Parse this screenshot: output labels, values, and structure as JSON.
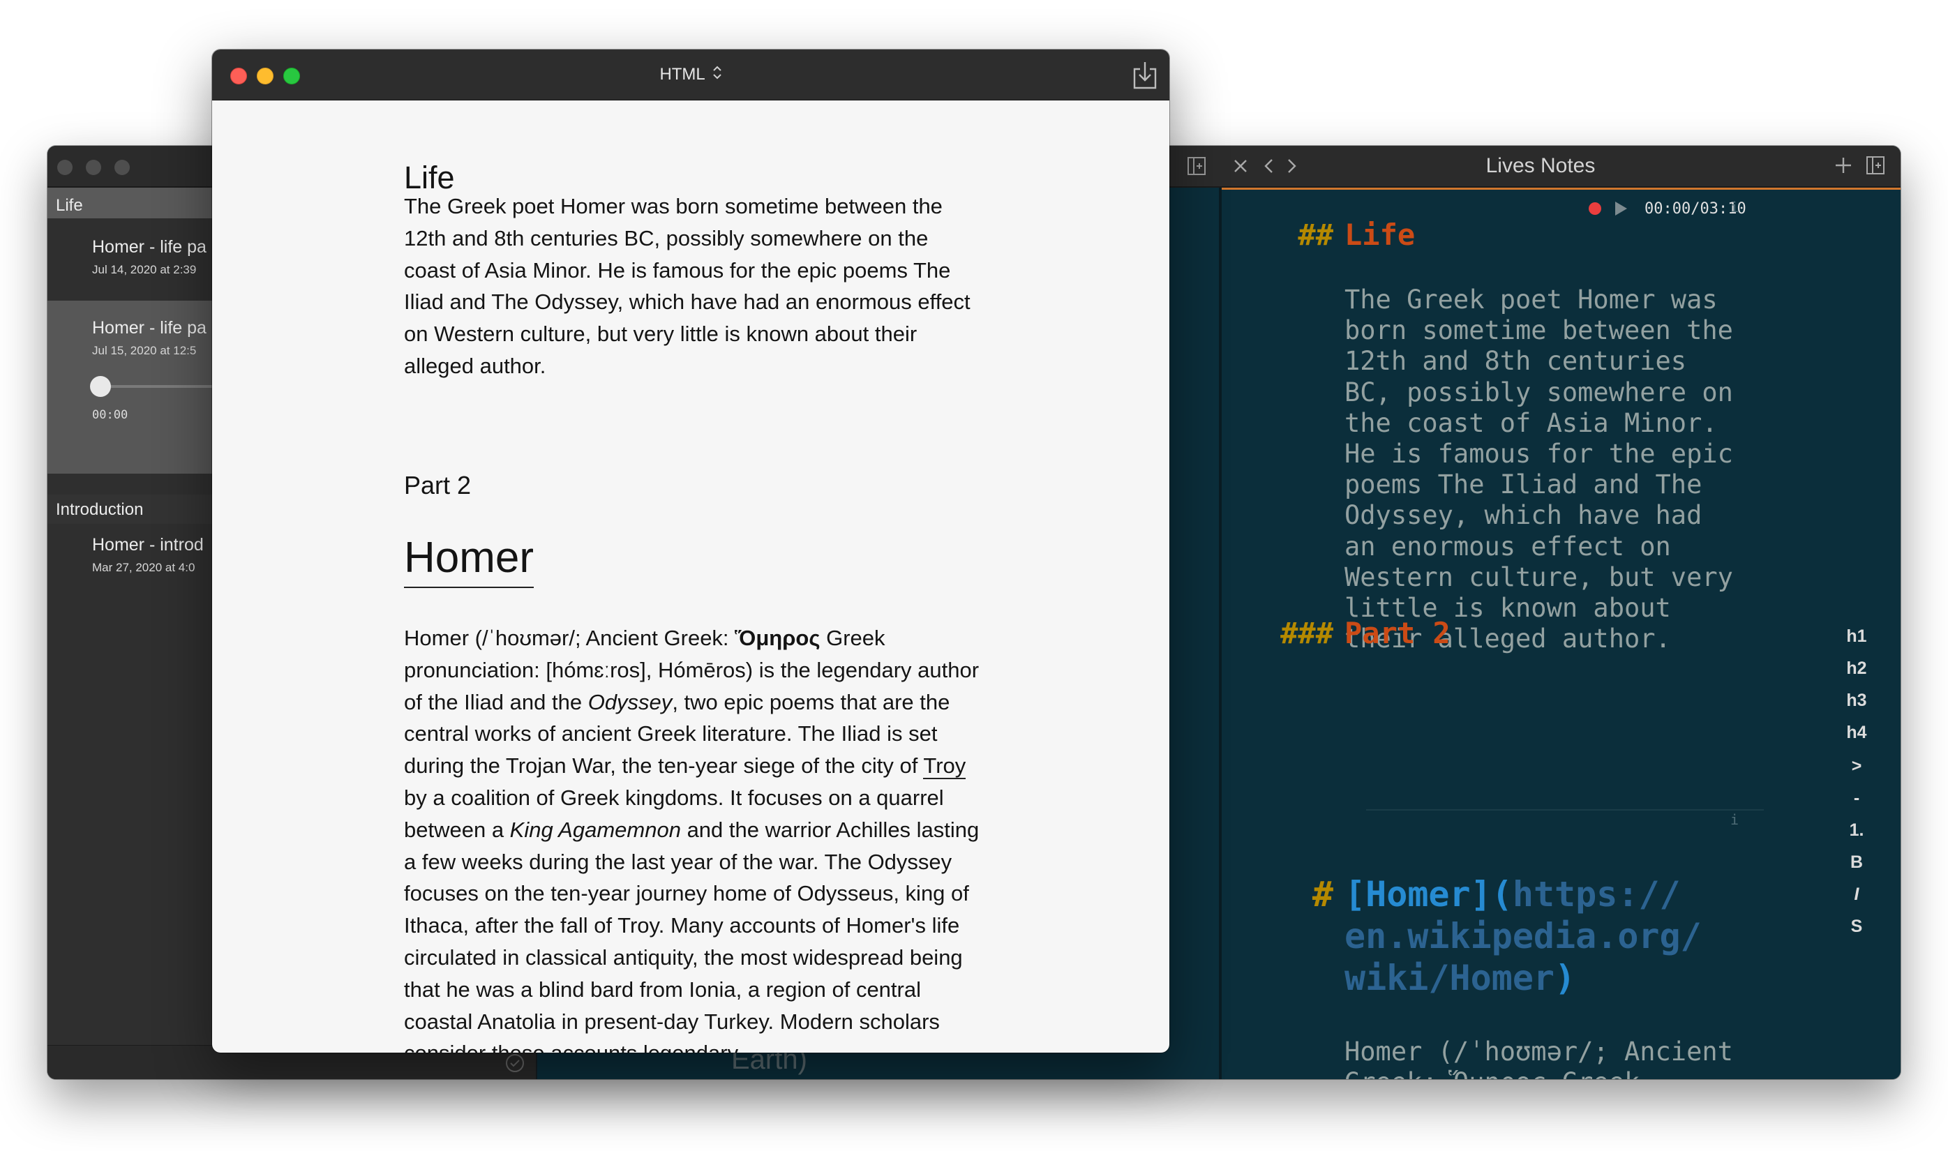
{
  "main_window": {
    "sidebar": {
      "sections": [
        {
          "label": "Life"
        },
        {
          "label": "Introduction"
        }
      ],
      "notes": [
        {
          "title": "Homer - life pa",
          "date": "Jul 14, 2020 at 2:39"
        },
        {
          "title": "Homer - life pa",
          "date": "Jul 15, 2020 at 12:5"
        },
        {
          "title": "Homer - introd",
          "date": "Mar 27, 2020 at 4:0"
        }
      ],
      "audio_time": "00:00"
    },
    "middle_pane_text": "Earth)",
    "editor": {
      "title": "Lives Notes",
      "audio_timer": "00:00/03:10",
      "info_glyph": "i",
      "line1": {
        "hashes": "##",
        "text": "Life"
      },
      "paragraph1": [
        "The Greek poet Homer was",
        "born sometime between the",
        "12th and 8th centuries",
        "BC, possibly somewhere on",
        "the coast of Asia Minor.",
        "He is famous for the epic",
        "poems The Iliad and The",
        "Odyssey, which have had",
        "an enormous effect on",
        "Western culture, but very",
        "little is known about",
        "their alleged author."
      ],
      "line2": {
        "hashes": "###",
        "text": "Part 2"
      },
      "heading_link": {
        "hash": "#",
        "open_bracket": "[",
        "text": "Homer",
        "close_bracket": "](",
        "url_lines": [
          "https://",
          "en.wikipedia.org/",
          "wiki/Homer"
        ],
        "close_paren": ")"
      },
      "last_line": "Homer (/ˈhoʊmər/; Ancient",
      "cut_line": "Greek: Ὅμηρος Greek",
      "format_bar": [
        "h1",
        "h2",
        "h3",
        "h4",
        ">",
        "-",
        "1.",
        "B",
        "I",
        "S"
      ]
    }
  },
  "preview_window": {
    "title": "HTML",
    "title_chevron": "⌃⌄",
    "heading_life": "Life",
    "paragraph_life": "The Greek poet Homer was born sometime between the 12th and 8th centuries BC, possibly somewhere on the coast of Asia Minor. He is famous for the epic poems The Iliad and The Odyssey, which have had an enormous effect on Western culture, but very little is known about their alleged author.",
    "heading_part2": "Part 2",
    "heading_homer": "Homer",
    "homer_paragraph": {
      "t1": "Homer (/ˈhoʊmər/; Ancient Greek: ",
      "greek": "Ὅμηρος",
      "t2": " Greek pronunciation: [hómɛːros], Hómēros) is the legendary author of the Iliad and the ",
      "odyssey": "Odyssey",
      "t3": ", two epic poems that are the central works of ancient Greek literature. The Iliad is set during the Trojan War, the ten-year siege of the city of ",
      "troy": "Troy",
      "t4": " by a coalition of Greek kingdoms. It focuses on a quarrel between a ",
      "agamemnon": "King Agamemnon",
      "t5": " and the warrior Achilles lasting a few weeks during the last year of the war. The Odyssey focuses on the ten-year journey home of Odysseus, king of Ithaca, after the fall of Troy. Many accounts of Homer's life circulated in classical antiquity, the most widespread being that he was a blind bard from Ionia, a region of central coastal Anatolia in present-day Turkey. Modern scholars consider these accounts legendary."
    }
  },
  "colors": {
    "editor_bg": "#0b2e3b",
    "markdown_hash": "#b58900",
    "markdown_heading": "#cb4b16",
    "link_text": "#268bd2",
    "link_url": "#2c6391",
    "body_text": "#93a1a1",
    "active_tab_border": "#d1772e",
    "record_red": "#ea3e3e"
  }
}
